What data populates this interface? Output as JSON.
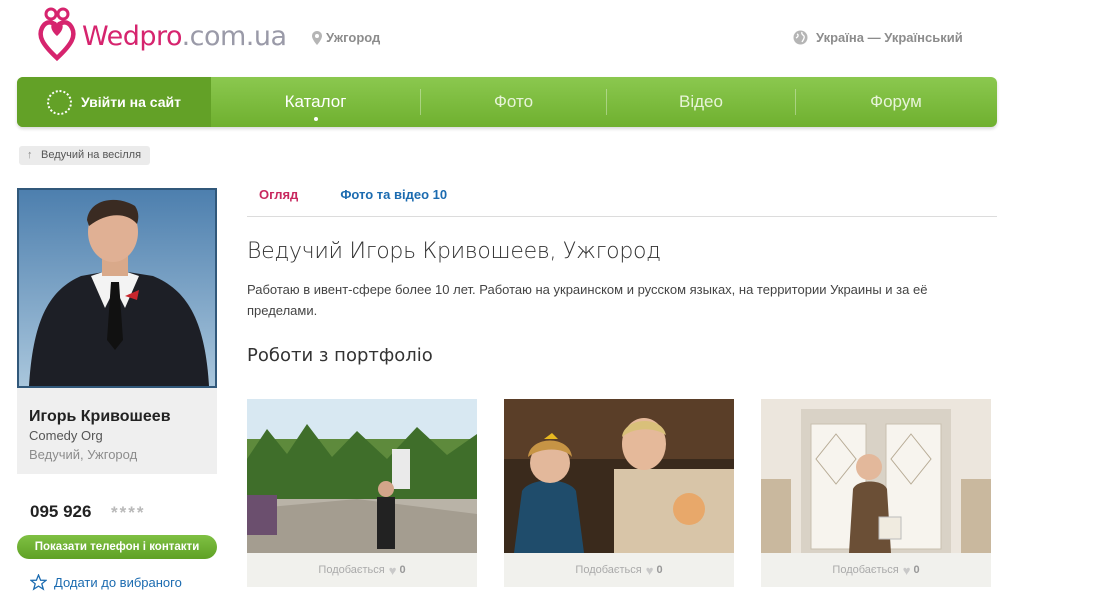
{
  "header": {
    "logo_main": "Wedpro",
    "logo_domain": ".com.ua",
    "city": "Ужгород",
    "locale": "Україна — Український"
  },
  "nav": {
    "login": "Увійти на сайт",
    "items": [
      "Каталог",
      "Фото",
      "Відео",
      "Форум"
    ]
  },
  "breadcrumb": "Ведучий на весілля",
  "profile": {
    "name": "Игорь Кривошеев",
    "org": "Comedy Org",
    "role": "Ведучий, Ужгород",
    "phone": "095 926",
    "phone_hidden": "****",
    "show_contacts": "Показати телефон і контакти",
    "add_favorite": "Додати до вибраного"
  },
  "tabs": [
    "Огляд",
    "Фото та відео 10"
  ],
  "content": {
    "title": "Ведучий Игорь Кривошеев, Ужгород",
    "description": "Работаю в ивент-сфере более 10 лет. Работаю на украинском и русском языках, на территории Украины и за её пределами.",
    "portfolio_title": "Роботи з портфоліо"
  },
  "portfolio": [
    {
      "likes_label": "Подобається",
      "likes": "0"
    },
    {
      "likes_label": "Подобається",
      "likes": "0"
    },
    {
      "likes_label": "Подобається",
      "likes": "0"
    }
  ],
  "colors": {
    "brand": "#d6246e",
    "nav_green": "#7bbd3c",
    "link_blue": "#1b6bb0"
  }
}
